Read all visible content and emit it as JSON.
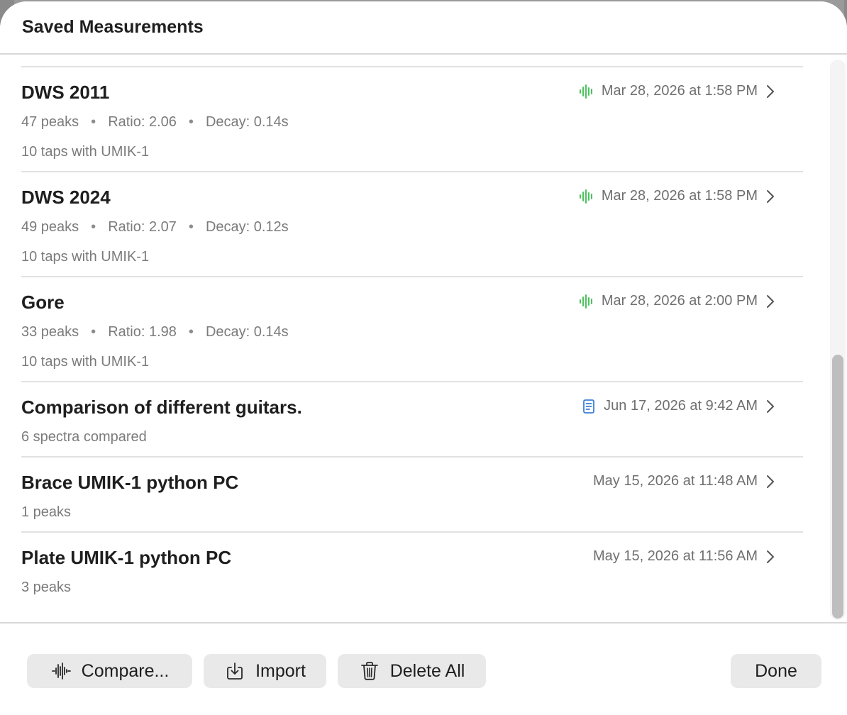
{
  "window": {
    "title": "Saved Measurements"
  },
  "measurements": [
    {
      "name": "DWS 2011",
      "meta": [
        "47 peaks",
        "Ratio: 2.06",
        "Decay: 0.14s"
      ],
      "sub": "10 taps with UMIK-1",
      "date": "Mar 28, 2026 at 1:58 PM",
      "icon": "waveform-icon"
    },
    {
      "name": "DWS 2024",
      "meta": [
        "49 peaks",
        "Ratio: 2.07",
        "Decay: 0.12s"
      ],
      "sub": "10 taps with UMIK-1",
      "date": "Mar 28, 2026 at 1:58 PM",
      "icon": "waveform-icon"
    },
    {
      "name": "Gore",
      "meta": [
        "33 peaks",
        "Ratio: 1.98",
        "Decay: 0.14s"
      ],
      "sub": "10 taps with UMIK-1",
      "date": "Mar 28, 2026 at 2:00 PM",
      "icon": "waveform-icon"
    },
    {
      "name": "Comparison of different guitars.",
      "meta": [
        "6 spectra compared"
      ],
      "sub": "",
      "date": "Jun 17, 2026 at 9:42 AM",
      "icon": "document-icon"
    },
    {
      "name": "Brace UMIK-1 python PC",
      "meta": [
        "1 peaks"
      ],
      "sub": "",
      "date": "May 15, 2026 at 11:48 AM",
      "icon": ""
    },
    {
      "name": "Plate UMIK-1 python PC",
      "meta": [
        "3 peaks"
      ],
      "sub": "",
      "date": "May 15, 2026 at 11:56 AM",
      "icon": ""
    }
  ],
  "separator": "•",
  "footer": {
    "compare_label": "Compare...",
    "import_label": "Import",
    "delete_all_label": "Delete All",
    "done_label": "Done"
  },
  "colors": {
    "waveform": "#4cc35f",
    "document": "#3d7fd8",
    "secondary_text": "#7b7b7b",
    "button_bg": "#e9e9e9"
  }
}
